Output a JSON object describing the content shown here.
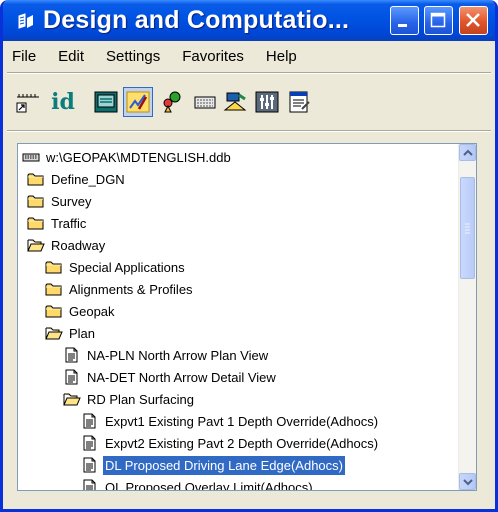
{
  "window": {
    "title": "Design and Computatio...",
    "controls": {
      "minimize": "_",
      "maximize": "□",
      "close": "×"
    }
  },
  "menu": [
    "File",
    "Edit",
    "Settings",
    "Favorites",
    "Help"
  ],
  "toolbar": {
    "id_label": "id",
    "tools": [
      "ruler-icon",
      "id-icon",
      "display-icon",
      "design-mode-icon",
      "shapes-icon",
      "keyin-icon",
      "draw-icon",
      "adjust-icon",
      "properties-icon"
    ],
    "active_tool": "design-mode-icon"
  },
  "tree": {
    "root": "w:\\GEOPAK\\MDTENGLISH.ddb",
    "items": [
      {
        "label": "Define_DGN",
        "type": "folder"
      },
      {
        "label": "Survey",
        "type": "folder"
      },
      {
        "label": "Traffic",
        "type": "folder"
      },
      {
        "label": "Roadway",
        "type": "folder-open"
      },
      {
        "label": "Special Applications",
        "type": "folder"
      },
      {
        "label": "Alignments & Profiles",
        "type": "folder"
      },
      {
        "label": "Geopak",
        "type": "folder"
      },
      {
        "label": "Plan",
        "type": "folder-open"
      },
      {
        "label": "NA-PLN North Arrow Plan View",
        "type": "item"
      },
      {
        "label": "NA-DET North Arrow Detail View",
        "type": "item"
      },
      {
        "label": "RD Plan Surfacing",
        "type": "folder-open"
      },
      {
        "label": "Expvt1 Existing Pavt 1 Depth Override(Adhocs)",
        "type": "item"
      },
      {
        "label": "Expvt2 Existing Pavt 2 Depth Override(Adhocs)",
        "type": "item"
      },
      {
        "label": "DL Proposed Driving Lane Edge(Adhocs)",
        "type": "item",
        "selected": true
      },
      {
        "label": "OL Proposed Overlay Limit(Adhocs)",
        "type": "item"
      }
    ]
  },
  "colors": {
    "titlebar": "#0054e3",
    "selection": "#316ac5",
    "folder": "#ffd96a",
    "window_bg": "#ece9d8"
  }
}
